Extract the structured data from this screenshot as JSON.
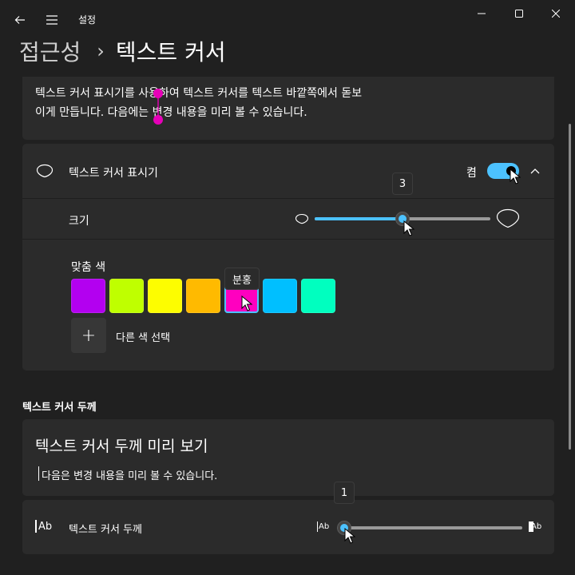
{
  "titlebar": {
    "app_title": "설정"
  },
  "header": {
    "breadcrumb_parent": "접근성",
    "separator": "›",
    "page_title": "텍스트 커서"
  },
  "intro": {
    "line1": "텍스트 커서 표시기를 사용하여 텍스트 커서를 텍스트 바깥쪽에서 돋보",
    "line2": "이게 만듭니다. 다음에는 변경 내용을 미리 볼 수 있습니다."
  },
  "indicator": {
    "label": "텍스트 커서 표시기",
    "toggle_state": "켬",
    "toggle_on": true,
    "size_label": "크기",
    "size_value": "3",
    "size_fraction": 0.5,
    "custom_color_label": "맞춤 색",
    "colors": [
      {
        "name": "purple",
        "hex": "#b300f0"
      },
      {
        "name": "lime",
        "hex": "#bfff00"
      },
      {
        "name": "yellow",
        "hex": "#fdfd00"
      },
      {
        "name": "orange",
        "hex": "#ffba00"
      },
      {
        "name": "pink",
        "hex": "#ff00bf"
      },
      {
        "name": "sky-blue",
        "hex": "#00bfff"
      },
      {
        "name": "mint",
        "hex": "#00ffbf"
      }
    ],
    "selected_color_tooltip": "분홍",
    "other_color_label": "다른 색 선택",
    "other_color_plus": "+"
  },
  "thickness": {
    "section_title": "텍스트 커서 두께",
    "preview_title": "텍스트 커서 두께 미리 보기",
    "preview_text": "다음은 변경 내용을 미리 볼 수 있습니다.",
    "row_label": "텍스트 커서 두께",
    "value": "1",
    "fraction": 0.0,
    "icon_left": "Ab",
    "icon_right": "Ab"
  },
  "colors": {
    "accent": "#4cc2ff",
    "background": "#202020",
    "card": "#2b2b2b"
  }
}
